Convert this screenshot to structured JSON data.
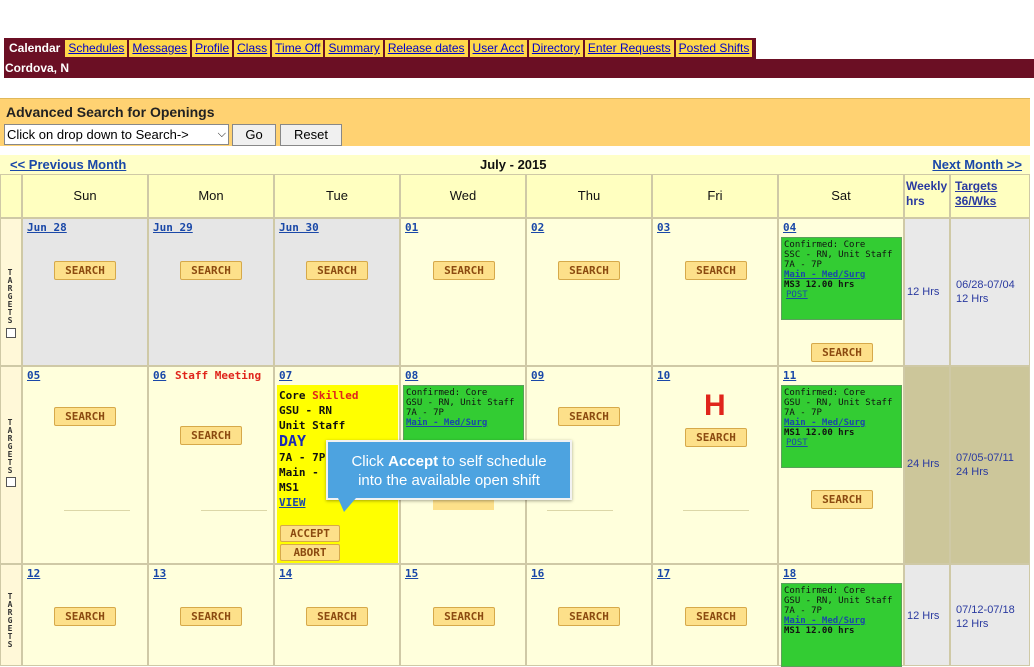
{
  "nav": {
    "tabs": [
      "Calendar",
      "Schedules",
      "Messages",
      "Profile",
      "Class",
      "Time Off",
      "Summary",
      "Release dates",
      "User Acct",
      "Directory",
      "Enter Requests",
      "Posted Shifts"
    ],
    "active": "Calendar"
  },
  "user": {
    "name": "Cordova, N"
  },
  "search": {
    "title": "Advanced Search for Openings",
    "select_value": "Click on drop down to Search->",
    "go_label": "Go",
    "reset_label": "Reset"
  },
  "month": {
    "prev_label": "<< Previous Month",
    "title": "July - 2015",
    "next_label": "Next Month >>"
  },
  "header": {
    "days": [
      "Sun",
      "Mon",
      "Tue",
      "Wed",
      "Thu",
      "Fri",
      "Sat"
    ],
    "weekly_label": "Weekly hrs",
    "targets_label": "Targets 36/Wks"
  },
  "targets_side_text": "TARGETS",
  "search_button_label": "SEARCH",
  "weeks": [
    {
      "dates": [
        "Jun 28",
        "Jun 29",
        "Jun 30",
        "01",
        "02",
        "03",
        "04"
      ],
      "weekly_hrs": "12 Hrs",
      "target_range": "06/28-07/04",
      "target_hrs": "12 Hrs"
    },
    {
      "dates": [
        "05",
        "06",
        "07",
        "08",
        "09",
        "10",
        "11"
      ],
      "weekly_hrs": "24 Hrs",
      "target_range": "07/05-07/11",
      "target_hrs": "24 Hrs"
    },
    {
      "dates": [
        "12",
        "13",
        "14",
        "15",
        "16",
        "17",
        "18"
      ],
      "weekly_hrs": "12 Hrs",
      "target_range": "07/12-07/18",
      "target_hrs": "12 Hrs"
    }
  ],
  "shifts": {
    "jul04": {
      "confirmed": "Confirmed: Core",
      "role": "SSC - RN, Unit Staff",
      "time": "7A - 7P",
      "location": "Main - Med/Surg",
      "unit_hrs": "MS3 12.00 hrs",
      "post": "POST"
    },
    "jul08": {
      "confirmed": "Confirmed: Core",
      "role": "GSU - RN, Unit Staff",
      "time": "7A - 7P",
      "location": "Main - Med/Surg"
    },
    "jul11": {
      "confirmed": "Confirmed: Core",
      "role": "GSU - RN, Unit Staff",
      "time": "7A - 7P",
      "location": "Main - Med/Surg",
      "unit_hrs": "MS1 12.00 hrs",
      "post": "POST"
    },
    "jul18": {
      "confirmed": "Confirmed: Core",
      "role": "GSU - RN, Unit Staff",
      "time": "7A - 7P",
      "location": "Main - Med/Surg",
      "unit_hrs": "MS1 12.00 hrs"
    }
  },
  "staff_meeting": "Staff Meeting",
  "holiday_marker": "H",
  "core_shift": {
    "core": "Core",
    "skilled": "Skilled",
    "role": "GSU - RN",
    "staff": "Unit Staff",
    "shift": "DAY",
    "time": "7A - 7P",
    "location": "Main - I",
    "unit": "MS1",
    "view": "VIEW",
    "accept": "ACCEPT",
    "abort": "ABORT"
  },
  "tooltip": {
    "pre": "Click ",
    "bold": "Accept",
    "post": " to self schedule",
    "line2": "into the available open shift"
  }
}
